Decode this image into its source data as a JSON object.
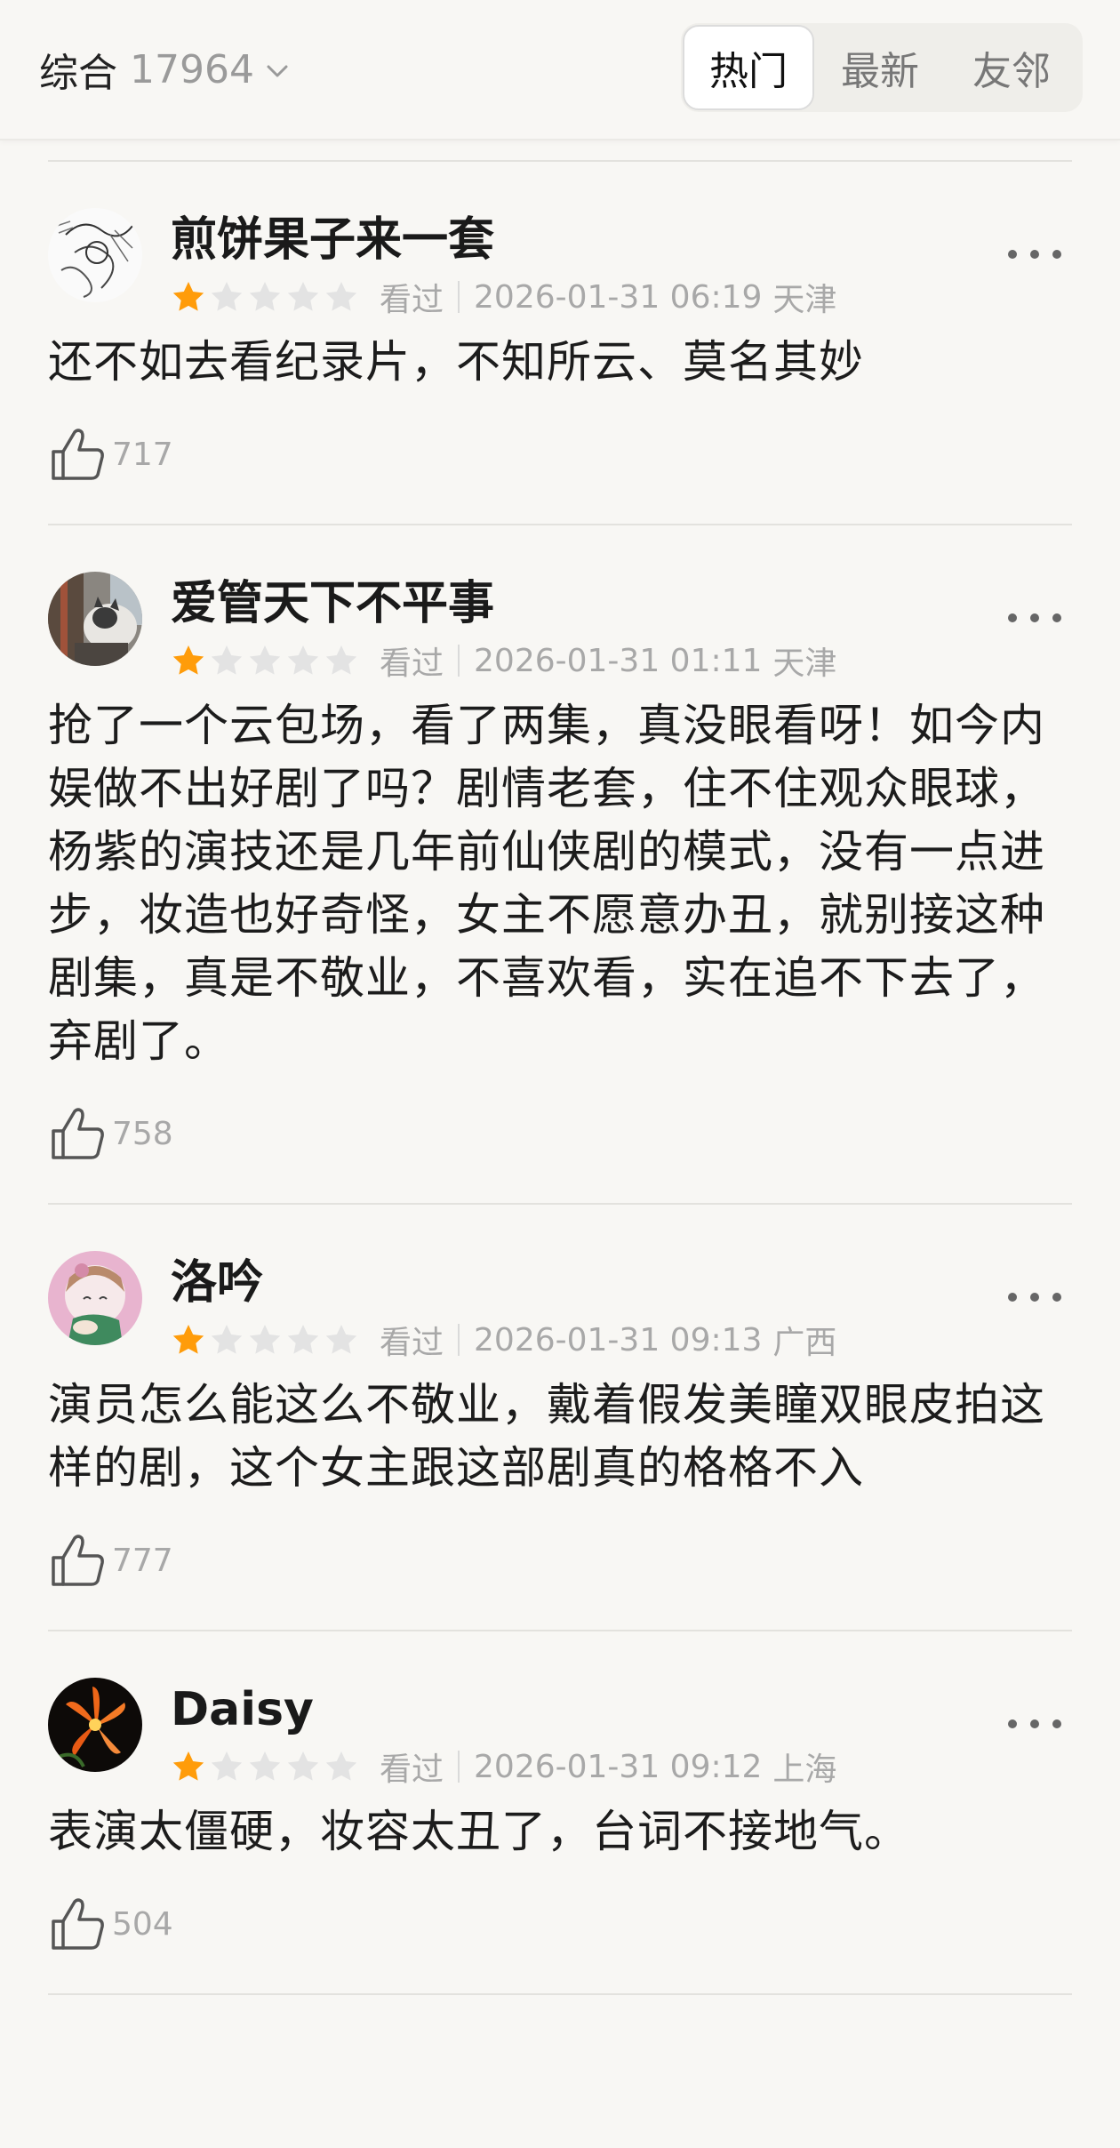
{
  "header": {
    "sort_label": "综合",
    "count": "17964",
    "tabs": [
      {
        "label": "热门",
        "active": true
      },
      {
        "label": "最新",
        "active": false
      },
      {
        "label": "友邻",
        "active": false
      }
    ]
  },
  "colors": {
    "star_filled": "#ff9c0a",
    "star_empty": "#e3e3e3",
    "meta_text": "#a8a8a8"
  },
  "reviews": [
    {
      "username": "煎饼果子来一套",
      "rating": 1,
      "status": "看过",
      "time": "2026-01-31 06:19",
      "location": "天津",
      "comment": "还不如去看纪录片，不知所云、莫名其妙",
      "likes": "717",
      "avatar_icon": "ink-sketch-avatar"
    },
    {
      "username": "爱管天下不平事",
      "rating": 1,
      "status": "看过",
      "time": "2026-01-31 01:11",
      "location": "天津",
      "comment": "抢了一个云包场，看了两集，真没眼看呀！如今内娱做不出好剧了吗？剧情老套，住不住观众眼球，杨紫的演技还是几年前仙侠剧的模式，没有一点进步，妆造也好奇怪，女主不愿意办丑，就别接这种剧集，真是不敬业，不喜欢看，实在追不下去了，弃剧了。",
      "likes": "758",
      "avatar_icon": "cat-photo-avatar"
    },
    {
      "username": "洛吟",
      "rating": 1,
      "status": "看过",
      "time": "2026-01-31 09:13",
      "location": "广西",
      "comment": "演员怎么能这么不敬业，戴着假发美瞳双眼皮拍这样的剧，这个女主跟这部剧真的格格不入",
      "likes": "777",
      "avatar_icon": "anime-girl-avatar"
    },
    {
      "username": "Daisy",
      "rating": 1,
      "status": "看过",
      "time": "2026-01-31 09:12",
      "location": "上海",
      "comment": "表演太僵硬，妆容太丑了，台词不接地气。",
      "likes": "504",
      "avatar_icon": "orange-flower-avatar"
    }
  ]
}
